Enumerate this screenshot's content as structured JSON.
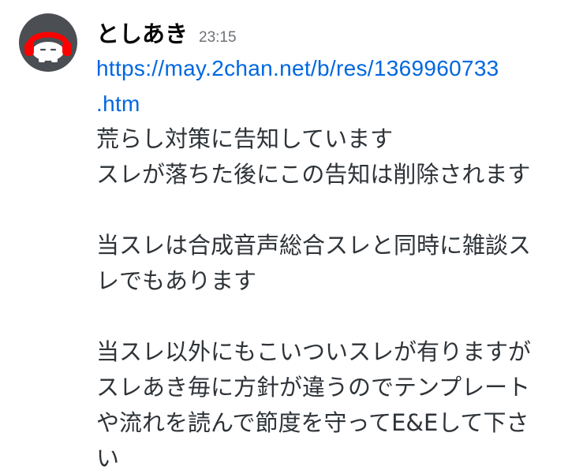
{
  "message": {
    "username": "としあき",
    "timestamp": "23:15",
    "avatar_icon": "red-headphones-face-icon",
    "link": {
      "line1": "https://may.2chan.net/b/res/1369960733",
      "line2": ".htm"
    },
    "lines": [
      "荒らし対策に告知しています",
      "スレが落ちた後にこの告知は削除されます",
      "",
      "当スレは合成音声総合スレと同時に雑談ス",
      "レでもあります",
      "",
      "当スレ以外にもこいついスレが有りますが",
      "スレあき毎に方針が違うのでテンプレート",
      "や流れを読んで節度を守ってE&Eして下さ",
      "い"
    ]
  },
  "colors": {
    "username": "#060607",
    "timestamp": "#6d7177",
    "text": "#2e3338",
    "link": "#0067e0",
    "avatar_bg": "#4b4e53",
    "avatar_accent": "#ff0000"
  }
}
